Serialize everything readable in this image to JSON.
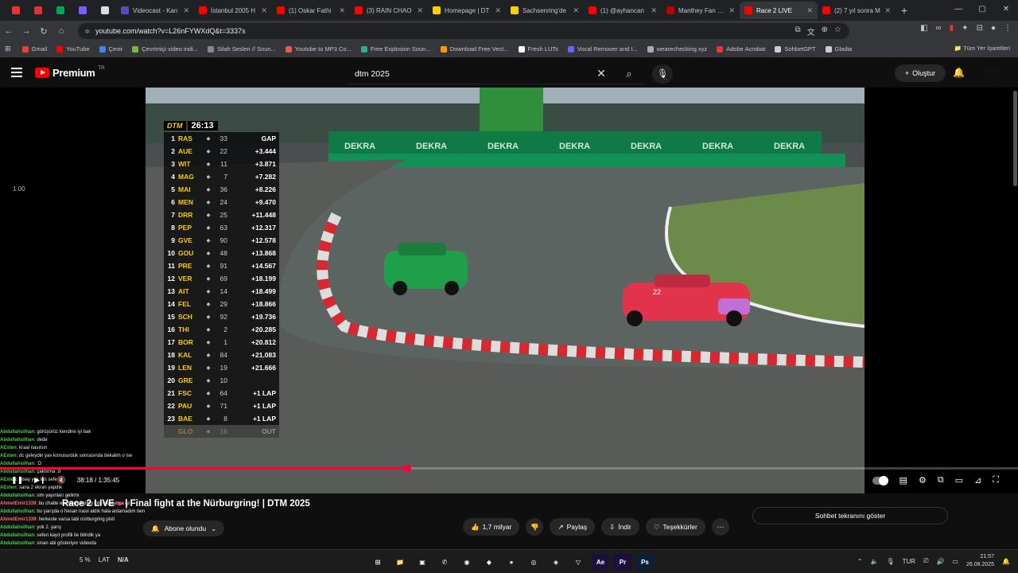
{
  "tabs": [
    {
      "label": "",
      "color": "#e33",
      "pinned": true
    },
    {
      "label": "",
      "color": "#d33",
      "pinned": true
    },
    {
      "label": "",
      "color": "#00a651",
      "pinned": true
    },
    {
      "label": "",
      "color": "#7b5cff",
      "pinned": true
    },
    {
      "label": "",
      "color": "#ddd",
      "pinned": true
    },
    {
      "label": "Videocast - Kan",
      "color": "#5a4bb5"
    },
    {
      "label": "İstanbul 2005 H",
      "color": "#f00"
    },
    {
      "label": "(1) Oskar Fathi",
      "color": "#f00"
    },
    {
      "label": "(3) RAIN CHAO",
      "color": "#f00"
    },
    {
      "label": "Homepage | DT",
      "color": "#ffd000"
    },
    {
      "label": "Sachsenring'de",
      "color": "#ffd000"
    },
    {
      "label": "(1) @ayhancan",
      "color": "#f00"
    },
    {
      "label": "Manthey Fan Ed",
      "color": "#b00"
    },
    {
      "label": "Race 2 LIVE",
      "color": "#f00",
      "active": true
    },
    {
      "label": "(2) 7 yıl sonra M",
      "color": "#f00"
    }
  ],
  "address": {
    "url": "youtube.com/watch?v=L26nFYWXdQ&t=3337s"
  },
  "bookmarks": [
    {
      "label": "Gmail",
      "color": "#ea4335"
    },
    {
      "label": "YouTube",
      "color": "#f00"
    },
    {
      "label": "Çevir",
      "color": "#4285f4"
    },
    {
      "label": "Çevrimiçi video indi...",
      "color": "#7cb342"
    },
    {
      "label": "Silah Sesleri // Soun...",
      "color": "#888"
    },
    {
      "label": "Youtube to MP3 Co...",
      "color": "#e55"
    },
    {
      "label": "Free Explosion Soun...",
      "color": "#3a8"
    },
    {
      "label": "Download Free Vect...",
      "color": "#f90"
    },
    {
      "label": "Fresh LUTs",
      "color": "#fff"
    },
    {
      "label": "Vocal Remover and I...",
      "color": "#66f"
    },
    {
      "label": "wearechecking.xyz",
      "color": "#aaa"
    },
    {
      "label": "Adobe Acrobat",
      "color": "#e33"
    },
    {
      "label": "SohbetGPT",
      "color": "#ccc"
    },
    {
      "label": "Gladia",
      "color": "#ccc"
    }
  ],
  "bookmarks_all": "Tüm Yer İşaretleri",
  "header": {
    "brand": "Premium",
    "region": "TR",
    "search_query": "dtm 2025",
    "create_label": "Oluştur"
  },
  "player": {
    "speed": "1.00",
    "time": "38:18 / 1:35:45",
    "progress": 0.4,
    "leaderboard": {
      "logo": "DTM",
      "clock": "26:13",
      "gap_header": "GAP",
      "rows": [
        {
          "pos": "1",
          "drv": "RAS",
          "num": "33",
          "gap": "GAP"
        },
        {
          "pos": "2",
          "drv": "AUE",
          "num": "22",
          "gap": "+3.444"
        },
        {
          "pos": "3",
          "drv": "WIT",
          "num": "11",
          "gap": "+3.871"
        },
        {
          "pos": "4",
          "drv": "MAG",
          "num": "7",
          "gap": "+7.282"
        },
        {
          "pos": "5",
          "drv": "MAI",
          "num": "36",
          "gap": "+8.226"
        },
        {
          "pos": "6",
          "drv": "MEN",
          "num": "24",
          "gap": "+9.470"
        },
        {
          "pos": "7",
          "drv": "DRR",
          "num": "25",
          "gap": "+11.448"
        },
        {
          "pos": "8",
          "drv": "PEP",
          "num": "63",
          "gap": "+12.317"
        },
        {
          "pos": "9",
          "drv": "GVE",
          "num": "90",
          "gap": "+12.578"
        },
        {
          "pos": "10",
          "drv": "GOU",
          "num": "48",
          "gap": "+13.868"
        },
        {
          "pos": "11",
          "drv": "PRE",
          "num": "91",
          "gap": "+14.567"
        },
        {
          "pos": "12",
          "drv": "VER",
          "num": "69",
          "gap": "+18.199"
        },
        {
          "pos": "13",
          "drv": "AIT",
          "num": "14",
          "gap": "+18.499"
        },
        {
          "pos": "14",
          "drv": "FEL",
          "num": "29",
          "gap": "+18.866"
        },
        {
          "pos": "15",
          "drv": "SCH",
          "num": "92",
          "gap": "+19.736"
        },
        {
          "pos": "16",
          "drv": "THI",
          "num": "2",
          "gap": "+20.285"
        },
        {
          "pos": "17",
          "drv": "BOR",
          "num": "1",
          "gap": "+20.812"
        },
        {
          "pos": "18",
          "drv": "KAL",
          "num": "84",
          "gap": "+21.083"
        },
        {
          "pos": "19",
          "drv": "LEN",
          "num": "19",
          "gap": "+21.666"
        },
        {
          "pos": "20",
          "drv": "GRE",
          "num": "10",
          "gap": ""
        },
        {
          "pos": "21",
          "drv": "FSC",
          "num": "64",
          "gap": "+1 LAP"
        },
        {
          "pos": "22",
          "drv": "PAU",
          "num": "71",
          "gap": "+1 LAP"
        },
        {
          "pos": "23",
          "drv": "BAE",
          "num": "8",
          "gap": "+1 LAP"
        },
        {
          "pos": "",
          "drv": "GLO",
          "num": "16",
          "gap": "OUT",
          "out": true
        }
      ]
    },
    "banners": [
      "DEKRA",
      "DEKRA",
      "DEKRA",
      "DEKRA",
      "DEKRA",
      "DEKRA",
      "DEKRA"
    ],
    "car1_number": "22"
  },
  "chat": [
    {
      "u": "Abdullahsilhan",
      "m": ": görüşürüz kendine iyi bak"
    },
    {
      "u": "Abdullahsilhan",
      "m": ": dede"
    },
    {
      "u": "AExten",
      "m": ": kraal nasılsın"
    },
    {
      "u": "AExten",
      "m": ": dc geleydin yav konusurduk sonrasında bekalim o ise"
    },
    {
      "u": "Abdullahsilhan",
      "m": ": :D"
    },
    {
      "u": "Abdullahsilhan",
      "m": ": çaktırma :d"
    },
    {
      "u": "AExten",
      "m": ": bisey yok lan sefe"
    },
    {
      "u": "AExten",
      "m": ": sana 2 ekran yapdık"
    },
    {
      "u": "Abdullahsilhan",
      "m": ": sim yayınları gelirmi"
    },
    {
      "u": "AhmetEmir1339",
      "m": ": bu chatte ecc nürburgring lobi oluşturma işi",
      "r": true
    },
    {
      "u": "Abdullahsilhan",
      "m": ": bu yarışda o hesan nasıl aldık hala anlamadım ben"
    },
    {
      "u": "AhmetEmir1339",
      "m": ": herkeste varsa tabi nürburgring pisti",
      "r": true
    },
    {
      "u": "Abdullahsilhan",
      "m": ": yok 2. yarış"
    },
    {
      "u": "Abdullahsilhan",
      "m": ": sefen kayıt profili ile bitirdik ya"
    },
    {
      "u": "Abdullahsilhan",
      "m": ": sinan abi gösteriyor videoda"
    }
  ],
  "video_title": {
    "text": "Race 2 LIVE",
    "rest": "| Final fight at the Nürburgring! | DTM 2025"
  },
  "channel": {
    "subscribed_label": "Abone olundu"
  },
  "actions": {
    "likes": "1,7 milyar",
    "share": "Paylaş",
    "download": "İndir",
    "thanks": "Teşekkürler"
  },
  "chat_toggle": "Sohbet tekranını göster",
  "taskbar": {
    "stat_fps": "5 %",
    "lat_label": "LAT",
    "lat_value": "N/A",
    "apps": [
      {
        "label": "⊞",
        "color": "#1c1c1c"
      },
      {
        "label": "📁",
        "color": "#1c1c1c"
      },
      {
        "label": "▣",
        "color": "#1c1c1c"
      },
      {
        "label": "✆",
        "color": "#1c1c1c"
      },
      {
        "label": "◉",
        "color": "#1c1c1c"
      },
      {
        "label": "◆",
        "color": "#1c1c1c"
      },
      {
        "label": "●",
        "color": "#1c1c1c"
      },
      {
        "label": "◎",
        "color": "#1c1c1c"
      },
      {
        "label": "◈",
        "color": "#1c1c1c"
      },
      {
        "label": "▽",
        "color": "#1c1c1c"
      },
      {
        "label": "Ae",
        "color": "#1a0f3d"
      },
      {
        "label": "Pr",
        "color": "#1a0f3d"
      },
      {
        "label": "Ps",
        "color": "#0b1f36"
      }
    ],
    "lang": "TUR",
    "time": "21:57",
    "date": "26.08.2025"
  }
}
